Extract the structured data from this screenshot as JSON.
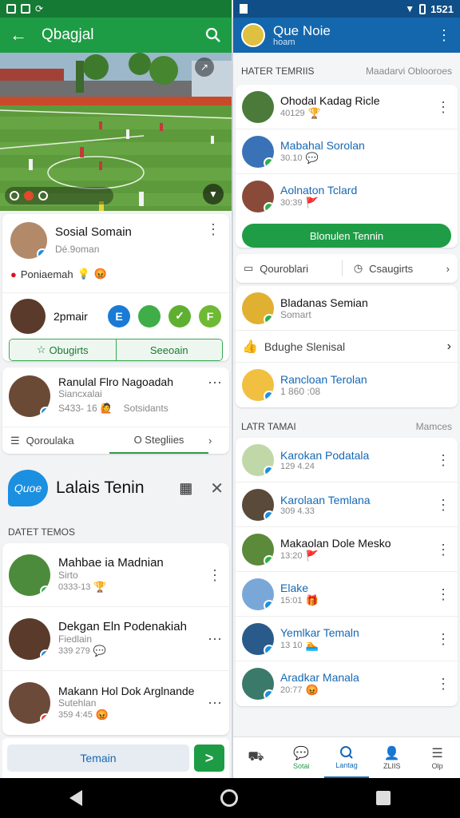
{
  "status_left": {
    "icons": [
      "sim-icon",
      "image-icon",
      "sync-icon"
    ]
  },
  "status_right": {
    "time": "1521"
  },
  "left": {
    "appbar": {
      "title": "Qbagjal"
    },
    "video": {
      "controls": [
        "cast-icon",
        "record-icon",
        "link-icon"
      ]
    },
    "social": {
      "name": "Sosial Somain",
      "handle": "Dé.9oman",
      "sub": "Poniaemah",
      "stat_name": "2pmair",
      "circles": [
        {
          "label": "E",
          "color": "#1a7bd6"
        },
        {
          "label": "",
          "color": "#3fae49"
        },
        {
          "label": "✓",
          "color": "#5fb031"
        },
        {
          "label": "F",
          "color": "#6fba35"
        }
      ],
      "btn_left": "Obugirts",
      "btn_right": "Seeoain"
    },
    "profile": {
      "name": "Ranulal Flro Nagoadah",
      "sub": "Siancxalai",
      "stats": "S433- 16",
      "tag": "Sotsidants",
      "tab1": "Qoroulaka",
      "tab2": "O Stegliies"
    },
    "quoe": {
      "logo": "Quoe",
      "title": "Lalais Tenin",
      "section": "DATET TEMOS"
    },
    "items": [
      {
        "name": "Mahbae ia Madnian",
        "sub": "Sirto",
        "meta": "0333-13",
        "bg": "#4c8b3c"
      },
      {
        "name": "Dekgan Eln Podenakiah",
        "sub": "Fiedlain",
        "meta": "339 279",
        "bg": "#5a3a2a"
      },
      {
        "name": "Makann Hol Dok Arglnande",
        "sub": "Sutehlan",
        "meta": "359 4:45",
        "bg": "#6b4a3a"
      }
    ],
    "bottom": {
      "team_label": "Temain",
      "go_label": ">"
    }
  },
  "right": {
    "appbar": {
      "title": "Que Noie",
      "subtitle": "hoam"
    },
    "section1": {
      "left": "HATER TEMRIIS",
      "right": "Maadarvi Oblooroes"
    },
    "top_items": [
      {
        "name": "Ohodal Kadag Ricle",
        "meta": "40129",
        "blue": false,
        "bg": "#4b7a3a"
      },
      {
        "name": "Mabahal Sorolan",
        "meta": "30.10",
        "blue": true,
        "bg": "#3a72b8"
      },
      {
        "name": "Aolnaton Tclard",
        "meta": "30:39",
        "blue": true,
        "bg": "#8a4a3a"
      }
    ],
    "green_btn": "Blonulen Tennin",
    "links": {
      "a": "Qouroblari",
      "b": "Csaugirts"
    },
    "mid_items": [
      {
        "name": "Bladanas Semian",
        "meta": "Somart",
        "blue": false,
        "bg": "#e0b030"
      },
      {
        "name": "Bdughe Slenisal",
        "meta": "",
        "blue": false,
        "bg": ""
      },
      {
        "name": "Rancloan Terolan",
        "meta": "1 860 :08",
        "blue": true,
        "bg": "#f2c040"
      }
    ],
    "section2": {
      "left": "LATR TAMAI",
      "right": "Mamces"
    },
    "latest": [
      {
        "name": "Karokan Podatala",
        "meta": "129 4.24",
        "bg": "#c0d8a8"
      },
      {
        "name": "Karolaan Temlana",
        "meta": "309 4.33",
        "bg": "#5a4a3a"
      },
      {
        "name": "Makaolan Dole Mesko",
        "meta": "13:20",
        "bg": "#5b8a3a",
        "black": true
      },
      {
        "name": "Elake",
        "meta": "15:01",
        "bg": "#79a8d8"
      },
      {
        "name": "Yemlkar Temaln",
        "meta": "13 10",
        "bg": "#2a5a8a"
      },
      {
        "name": "Aradkar Manala",
        "meta": "20:77",
        "bg": "#3a7a6a"
      }
    ],
    "tabbar": [
      {
        "label": "",
        "icon": "car-icon"
      },
      {
        "label": "Sotai",
        "icon": "chat-icon"
      },
      {
        "label": "Lantag",
        "icon": "search-icon"
      },
      {
        "label": "ZLIIS",
        "icon": "profile-icon"
      },
      {
        "label": "Olp",
        "icon": "menu-icon"
      }
    ]
  },
  "colors": {
    "green": "#1e9c45",
    "blue": "#1467ad",
    "link": "#1668b4"
  }
}
